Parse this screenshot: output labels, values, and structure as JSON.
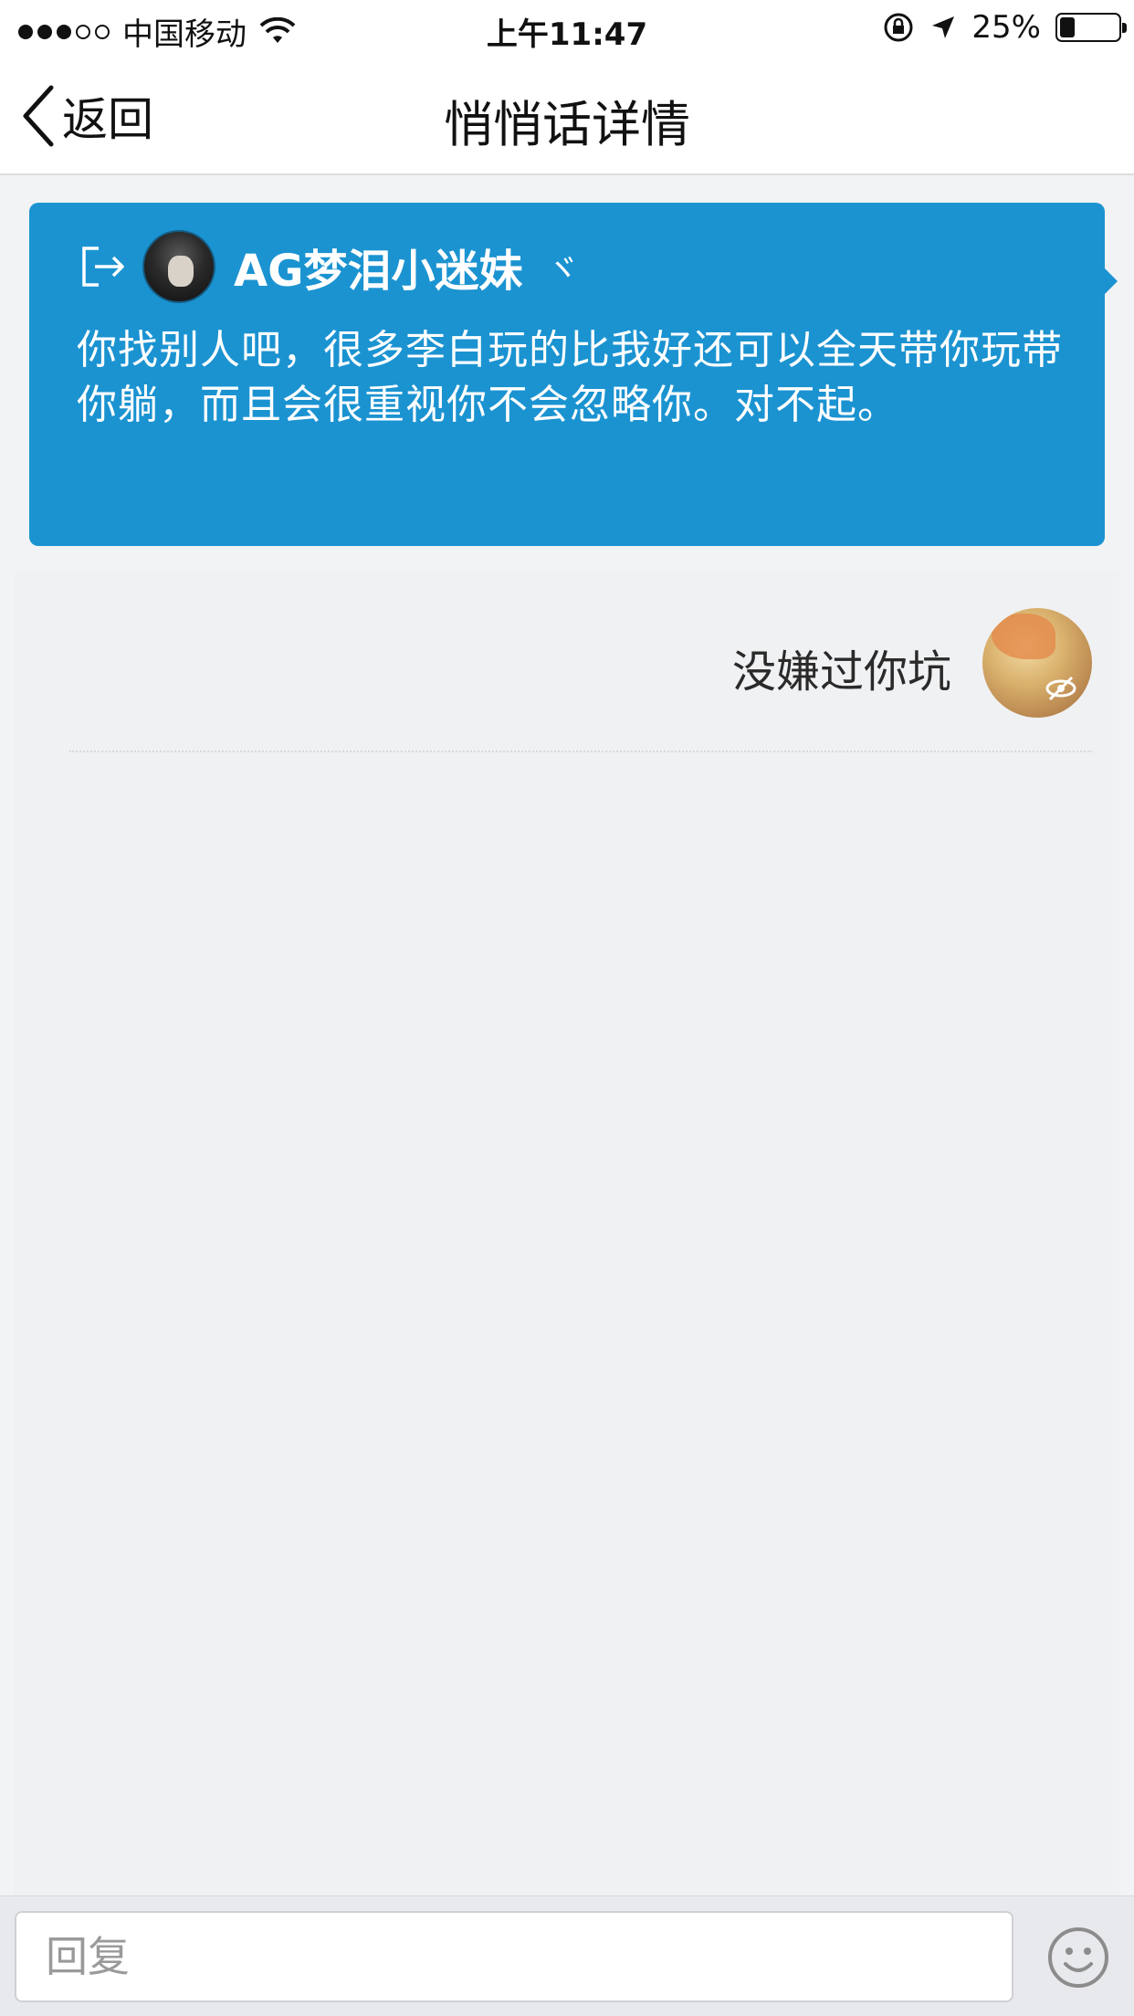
{
  "status_bar": {
    "carrier": "中国移动",
    "time": "上午11:47",
    "battery": "25%",
    "battery_level": 0.25
  },
  "nav": {
    "back_label": "返回",
    "title": "悄悄话详情"
  },
  "whisper": {
    "username": "AG梦泪小迷妹",
    "chevron": "ヾ",
    "message": "你找别人吧，很多李白玩的比我好还可以全天带你玩带你躺，而且会很重视你不会忽略你。对不起。"
  },
  "replies": [
    {
      "text": "没嫌过你坑"
    }
  ],
  "input": {
    "placeholder": "回复"
  },
  "colors": {
    "card_blue": "#1b93d1",
    "background": "#f2f3f5"
  },
  "icons": [
    "wifi-icon",
    "orientation-lock-icon",
    "location-arrow-icon",
    "battery-icon",
    "back-chevron-icon",
    "exit-icon",
    "chevron-down-icon",
    "hidden-eye-icon",
    "emoji-icon"
  ]
}
